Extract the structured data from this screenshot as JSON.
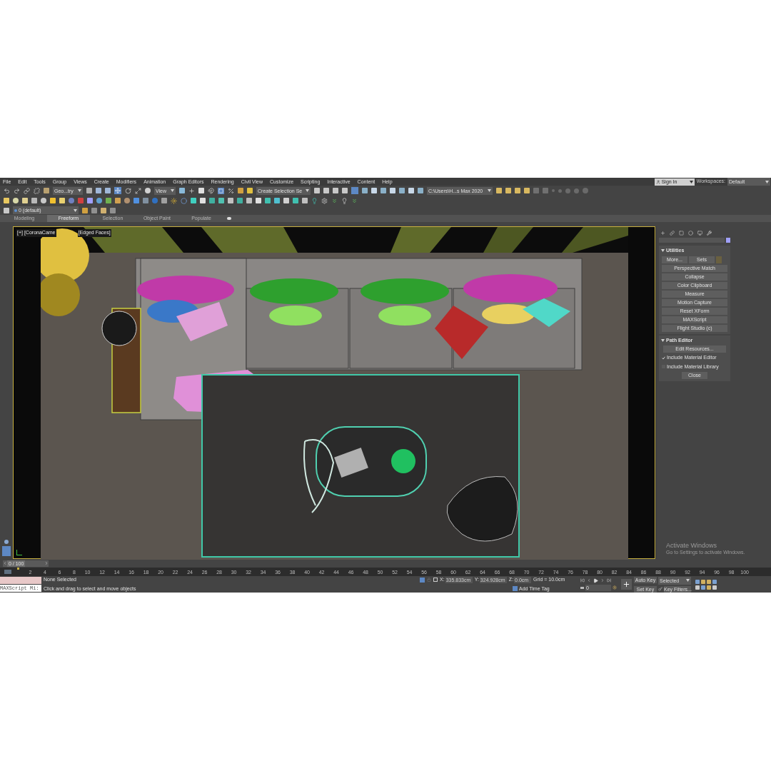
{
  "menu": [
    "File",
    "Edit",
    "Tools",
    "Group",
    "Views",
    "Create",
    "Modifiers",
    "Animation",
    "Graph Editors",
    "Rendering",
    "Civil View",
    "Customize",
    "Scripting",
    "Interactive",
    "Content",
    "Help"
  ],
  "account": {
    "sign_in": "Sign In",
    "workspaces_label": "Workspaces:",
    "workspace": "Default"
  },
  "toolbar": {
    "selection_filter": "Geo...try",
    "reference_coords": "View",
    "selection_set": "Create Selection Se",
    "project_path": "C:\\Users\\H...s Max 2020",
    "layer": "0 (default)"
  },
  "ribbon_tabs": [
    {
      "label": "Modeling",
      "selected": false
    },
    {
      "label": "Freeform",
      "selected": true
    },
    {
      "label": "Selection",
      "selected": false
    },
    {
      "label": "Object Paint",
      "selected": false
    },
    {
      "label": "Populate",
      "selected": false
    }
  ],
  "viewport": {
    "labels": [
      "[+] [CoronaCame",
      "[Edged Faces]"
    ]
  },
  "command_panel": {
    "utilities": {
      "title": "Utilities",
      "top_buttons": [
        "More...",
        "Sets"
      ],
      "buttons": [
        "Perspective Match",
        "Collapse",
        "Color Clipboard",
        "Measure",
        "Motion Capture",
        "Reset XForm",
        "MAXScript",
        "Flight Studio (c)"
      ]
    },
    "path_editor": {
      "title": "Path Editor",
      "button": "Edit Resources...",
      "options": [
        {
          "label": "Include Material Editor",
          "checked": true
        },
        {
          "label": "Include Material Library",
          "checked": false
        }
      ],
      "close": "Close"
    }
  },
  "timeline": {
    "frame": "0 / 100",
    "level": 0,
    "ticks": [
      "2",
      "4",
      "6",
      "8",
      "10",
      "12",
      "14",
      "16",
      "18",
      "20",
      "22",
      "24",
      "26",
      "28",
      "30",
      "32",
      "34",
      "36",
      "38",
      "40",
      "42",
      "44",
      "46",
      "48",
      "50",
      "52",
      "54",
      "56",
      "58",
      "60",
      "62",
      "64",
      "66",
      "68",
      "70",
      "72",
      "74",
      "76",
      "78",
      "80",
      "82",
      "84",
      "86",
      "88",
      "90",
      "92",
      "94",
      "96",
      "98",
      "100"
    ]
  },
  "status": {
    "listener": "MAXScript Mi:",
    "selection": "None Selected",
    "prompt": "Click and drag to select and move objects",
    "x_label": "X:",
    "x": "335.833cm",
    "y_label": "Y:",
    "y": "324.928cm",
    "z_label": "Z:",
    "z": "0.0cm",
    "grid": "Grid = 10.0cm",
    "time_tag": "Add Time Tag",
    "current_frame": "0",
    "auto_key": "Auto Key",
    "set_key": "Set Key",
    "key_mode": "Selected",
    "key_filters": "Key Filters..."
  },
  "os_notice": {
    "title": "Activate Windows",
    "text": "Go to Settings to activate Windows."
  }
}
